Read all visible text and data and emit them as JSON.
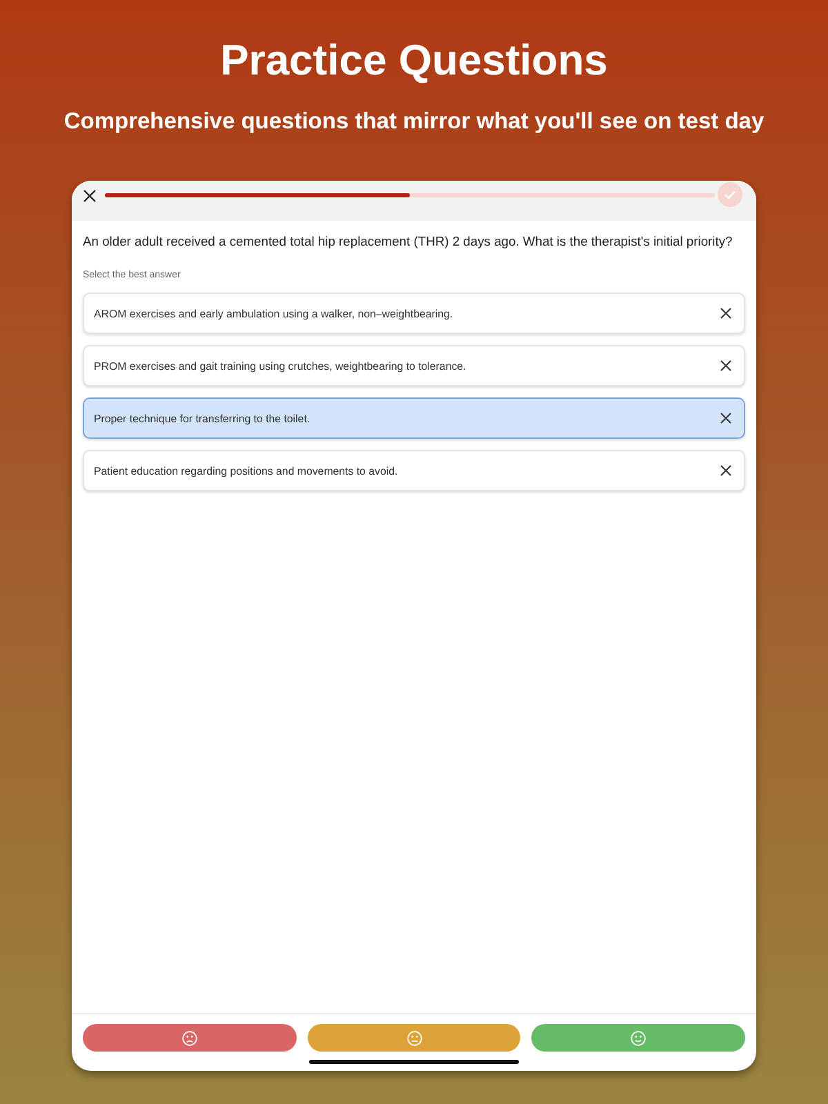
{
  "header": {
    "title": "Practice Questions",
    "subtitle": "Comprehensive questions that mirror what you'll see on test day"
  },
  "quiz": {
    "progress": {
      "level": 0.5
    },
    "question": "An older adult received a cemented total hip replacement (THR) 2 days ago. What is the therapist's initial priority?",
    "instruction": "Select the best answer",
    "options": [
      {
        "text": "AROM exercises and early ambulation using a walker, non–weightbearing.",
        "selected": false
      },
      {
        "text": "PROM exercises and gait training using crutches, weightbearing to tolerance.",
        "selected": false
      },
      {
        "text": "Proper technique for transferring to the toilet.",
        "selected": true
      },
      {
        "text": "Patient education regarding positions and movements to avoid.",
        "selected": false
      }
    ]
  },
  "rating_buttons": [
    {
      "kind": "sad",
      "color": "#d96666"
    },
    {
      "kind": "neutral",
      "color": "#dea338"
    },
    {
      "kind": "happy",
      "color": "#66bb66"
    }
  ]
}
